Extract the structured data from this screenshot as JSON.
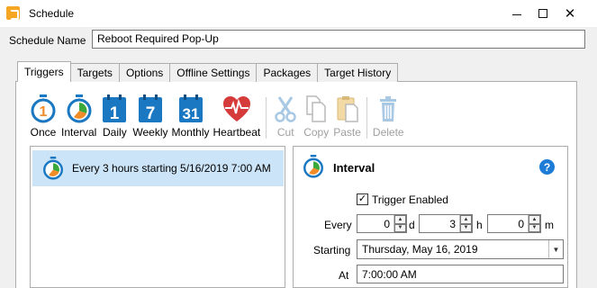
{
  "window": {
    "title": "Schedule"
  },
  "schedule_name": {
    "label": "Schedule Name",
    "value": "Reboot Required Pop-Up"
  },
  "tabs": [
    {
      "label": "Triggers",
      "active": true
    },
    {
      "label": "Targets"
    },
    {
      "label": "Options"
    },
    {
      "label": "Offline Settings"
    },
    {
      "label": "Packages"
    },
    {
      "label": "Target History"
    }
  ],
  "toolbar": {
    "once": {
      "label": "Once",
      "icon": "stopwatch-1-icon"
    },
    "interval": {
      "label": "Interval",
      "icon": "stopwatch-interval-icon"
    },
    "daily": {
      "label": "Daily",
      "icon": "calendar-1-icon",
      "day": "1"
    },
    "weekly": {
      "label": "Weekly",
      "icon": "calendar-7-icon",
      "day": "7"
    },
    "monthly": {
      "label": "Monthly",
      "icon": "calendar-31-icon",
      "day": "31"
    },
    "heartbeat": {
      "label": "Heartbeat",
      "icon": "heartbeat-icon"
    },
    "cut": {
      "label": "Cut",
      "icon": "scissors-icon"
    },
    "copy": {
      "label": "Copy",
      "icon": "copy-icon"
    },
    "paste": {
      "label": "Paste",
      "icon": "paste-icon"
    },
    "delete": {
      "label": "Delete",
      "icon": "trash-icon"
    }
  },
  "triggers": [
    {
      "text": "Every 3 hours starting 5/16/2019 7:00 AM",
      "selected": true
    }
  ],
  "detail": {
    "title": "Interval",
    "help": "?",
    "trigger_enabled_label": "Trigger Enabled",
    "trigger_enabled": true,
    "every_label": "Every",
    "days": "0",
    "days_unit": "d",
    "hours": "3",
    "hours_unit": "h",
    "minutes": "0",
    "minutes_unit": "m",
    "starting_label": "Starting",
    "starting_value": "Thursday, May 16, 2019",
    "at_label": "At",
    "at_value": "7:00:00 AM"
  },
  "colors": {
    "accent_blue": "#1a78c2",
    "orange": "#f28c28",
    "green": "#3aa83a",
    "heart_red": "#d63b3b",
    "selection": "#cce4f7"
  }
}
